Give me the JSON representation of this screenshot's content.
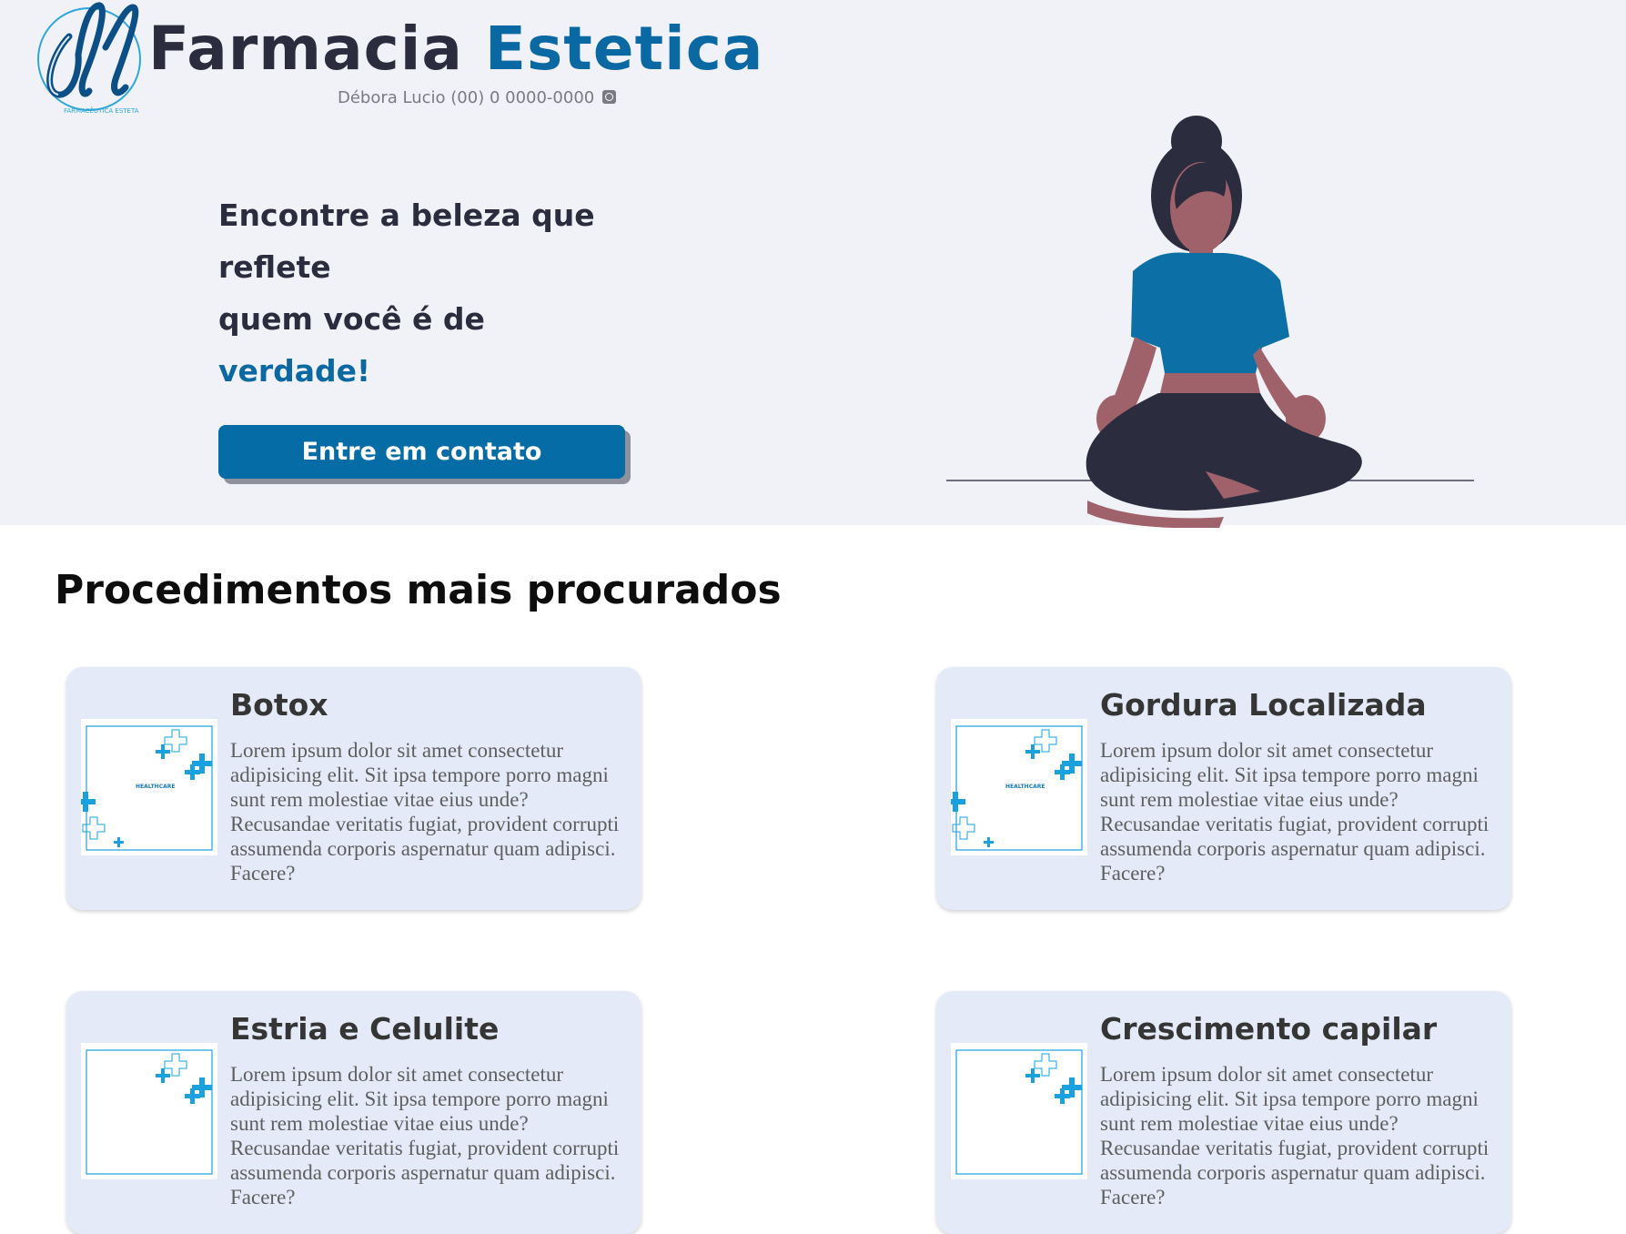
{
  "brand": {
    "logo_initials": "dl",
    "logo_ring_text": "FARMACÊUTICA ESTETA",
    "title_part1": "Farmacia",
    "title_part2": "Estetica",
    "contact": "Débora Lucio (00) 0 0000-0000",
    "contact_icon": "whatsapp-icon"
  },
  "hero": {
    "headline_line1": "Encontre a beleza que",
    "headline_line2": "reflete",
    "headline_line3": "quem você é de",
    "headline_accent": "verdade!",
    "cta_label": "Entre em contato",
    "illustration": "meditating-woman-illustration"
  },
  "procedures": {
    "section_title": "Procedimentos mais procurados",
    "thumb_text": "HEALTHCARE",
    "items": [
      {
        "title": "Botox",
        "text": "Lorem ipsum dolor sit amet consectetur adipisicing elit. Sit ipsa tempore porro magni sunt rem molestiae vitae eius unde? Recusandae veritatis fugiat, provident corrupti assumenda corporis aspernatur quam adipisci. Facere?"
      },
      {
        "title": "Gordura Localizada",
        "text": "Lorem ipsum dolor sit amet consectetur adipisicing elit. Sit ipsa tempore porro magni sunt rem molestiae vitae eius unde? Recusandae veritatis fugiat, provident corrupti assumenda corporis aspernatur quam adipisci. Facere?"
      },
      {
        "title": "Estria e Celulite",
        "text": "Lorem ipsum dolor sit amet consectetur adipisicing elit. Sit ipsa tempore porro magni sunt rem molestiae vitae eius unde? Recusandae veritatis fugiat, provident corrupti assumenda corporis aspernatur quam adipisci. Facere?"
      },
      {
        "title": "Crescimento capilar",
        "text": "Lorem ipsum dolor sit amet consectetur adipisicing elit. Sit ipsa tempore porro magni sunt rem molestiae vitae eius unde? Recusandae veritatis fugiat, provident corrupti assumenda corporis aspernatur quam adipisci. Facere?"
      }
    ]
  },
  "colors": {
    "accent": "#0a68a2",
    "button": "#066ca5",
    "hero_bg": "#f0f2f8",
    "card_bg": "#e5eaf8",
    "dark_text": "#2b2d3e"
  }
}
